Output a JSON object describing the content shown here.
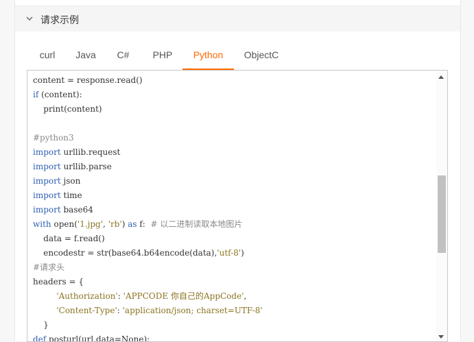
{
  "section": {
    "title": "请求示例",
    "collapse_icon": "chevron-down-icon"
  },
  "tabs": [
    "curl",
    "Java",
    "C#",
    "PHP",
    "Python",
    "ObjectC"
  ],
  "active_tab": "Python",
  "accent_color": "#ff6a00",
  "code_lines": [
    [
      {
        "t": "content = response.read()",
        "c": ""
      }
    ],
    [
      {
        "t": "if",
        "c": "kw"
      },
      {
        "t": " (content):",
        "c": ""
      }
    ],
    [
      {
        "t": "    print(content)",
        "c": ""
      }
    ],
    [
      {
        "t": "",
        "c": ""
      }
    ],
    [
      {
        "t": "#python3",
        "c": "cm"
      }
    ],
    [
      {
        "t": "import",
        "c": "kw"
      },
      {
        "t": " urllib.request",
        "c": ""
      }
    ],
    [
      {
        "t": "import",
        "c": "kw"
      },
      {
        "t": " urllib.parse",
        "c": ""
      }
    ],
    [
      {
        "t": "import",
        "c": "kw"
      },
      {
        "t": " json",
        "c": ""
      }
    ],
    [
      {
        "t": "import",
        "c": "kw"
      },
      {
        "t": " time",
        "c": ""
      }
    ],
    [
      {
        "t": "import",
        "c": "kw"
      },
      {
        "t": " base64",
        "c": ""
      }
    ],
    [
      {
        "t": "with",
        "c": "kw"
      },
      {
        "t": " open(",
        "c": ""
      },
      {
        "t": "'1.jpg'",
        "c": "str"
      },
      {
        "t": ", ",
        "c": ""
      },
      {
        "t": "'rb'",
        "c": "str"
      },
      {
        "t": ") ",
        "c": ""
      },
      {
        "t": "as",
        "c": "kw"
      },
      {
        "t": " f:  ",
        "c": ""
      },
      {
        "t": "# 以二进制读取本地图片",
        "c": "cm"
      }
    ],
    [
      {
        "t": "    data = f.read()",
        "c": ""
      }
    ],
    [
      {
        "t": "    encodestr = str(base64.b64encode(data),",
        "c": ""
      },
      {
        "t": "'utf-8'",
        "c": "str"
      },
      {
        "t": ")",
        "c": ""
      }
    ],
    [
      {
        "t": "#请求头",
        "c": "cm"
      }
    ],
    [
      {
        "t": "headers = {",
        "c": ""
      }
    ],
    [
      {
        "t": "         ",
        "c": ""
      },
      {
        "t": "'Authorization'",
        "c": "str"
      },
      {
        "t": ": ",
        "c": ""
      },
      {
        "t": "'APPCODE 你自己的AppCode'",
        "c": "str"
      },
      {
        "t": ",",
        "c": ""
      }
    ],
    [
      {
        "t": "         ",
        "c": ""
      },
      {
        "t": "'Content-Type'",
        "c": "str"
      },
      {
        "t": ": ",
        "c": ""
      },
      {
        "t": "'application/json; charset=UTF-8'",
        "c": "str"
      }
    ],
    [
      {
        "t": "    }",
        "c": ""
      }
    ],
    [
      {
        "t": "def",
        "c": "kw"
      },
      {
        "t": " posturl(url,data=None):",
        "c": ""
      }
    ]
  ]
}
